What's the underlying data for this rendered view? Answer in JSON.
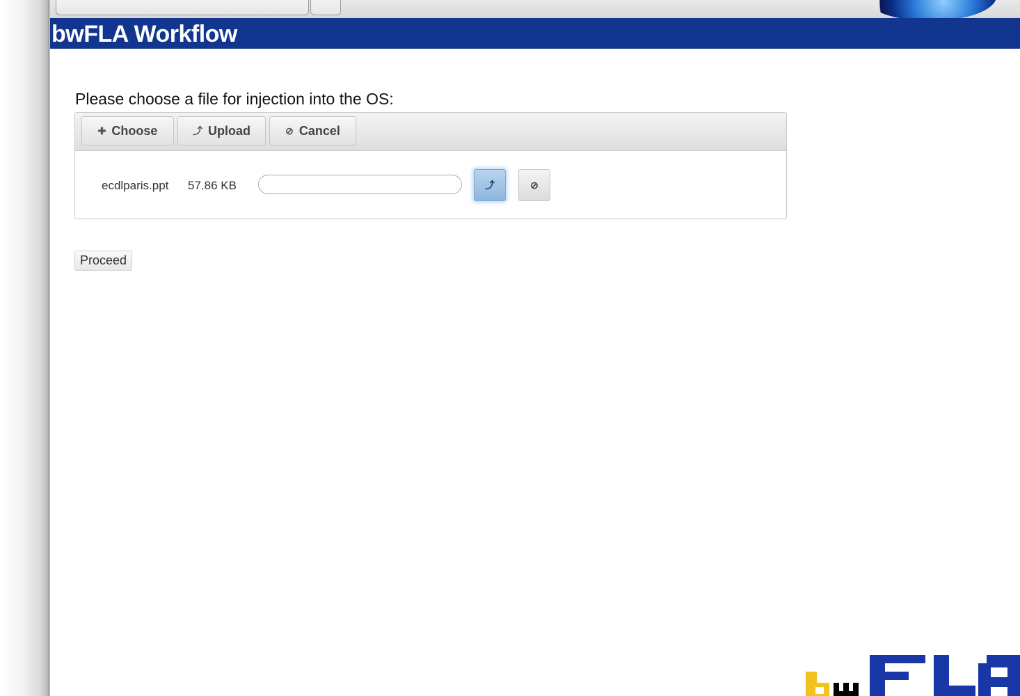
{
  "browser": {
    "url_text": "..."
  },
  "header": {
    "title": "bwFLA Workflow",
    "background_color": "#12368f"
  },
  "prompt": {
    "text": "Please choose a file for injection into the OS:"
  },
  "uploader": {
    "toolbar": {
      "choose_label": "Choose",
      "choose_icon": "plus-icon",
      "upload_label": "Upload",
      "upload_icon": "upload-arrow-icon",
      "cancel_label": "Cancel",
      "cancel_icon": "cancel-circle-icon"
    },
    "file": {
      "name": "ecdlparis.ppt",
      "size": "57.86 KB",
      "progress": 0,
      "upload_icon": "upload-arrow-icon",
      "remove_icon": "cancel-circle-icon"
    }
  },
  "actions": {
    "proceed_label": "Proceed"
  },
  "footer": {
    "logo": "bwFLA"
  }
}
